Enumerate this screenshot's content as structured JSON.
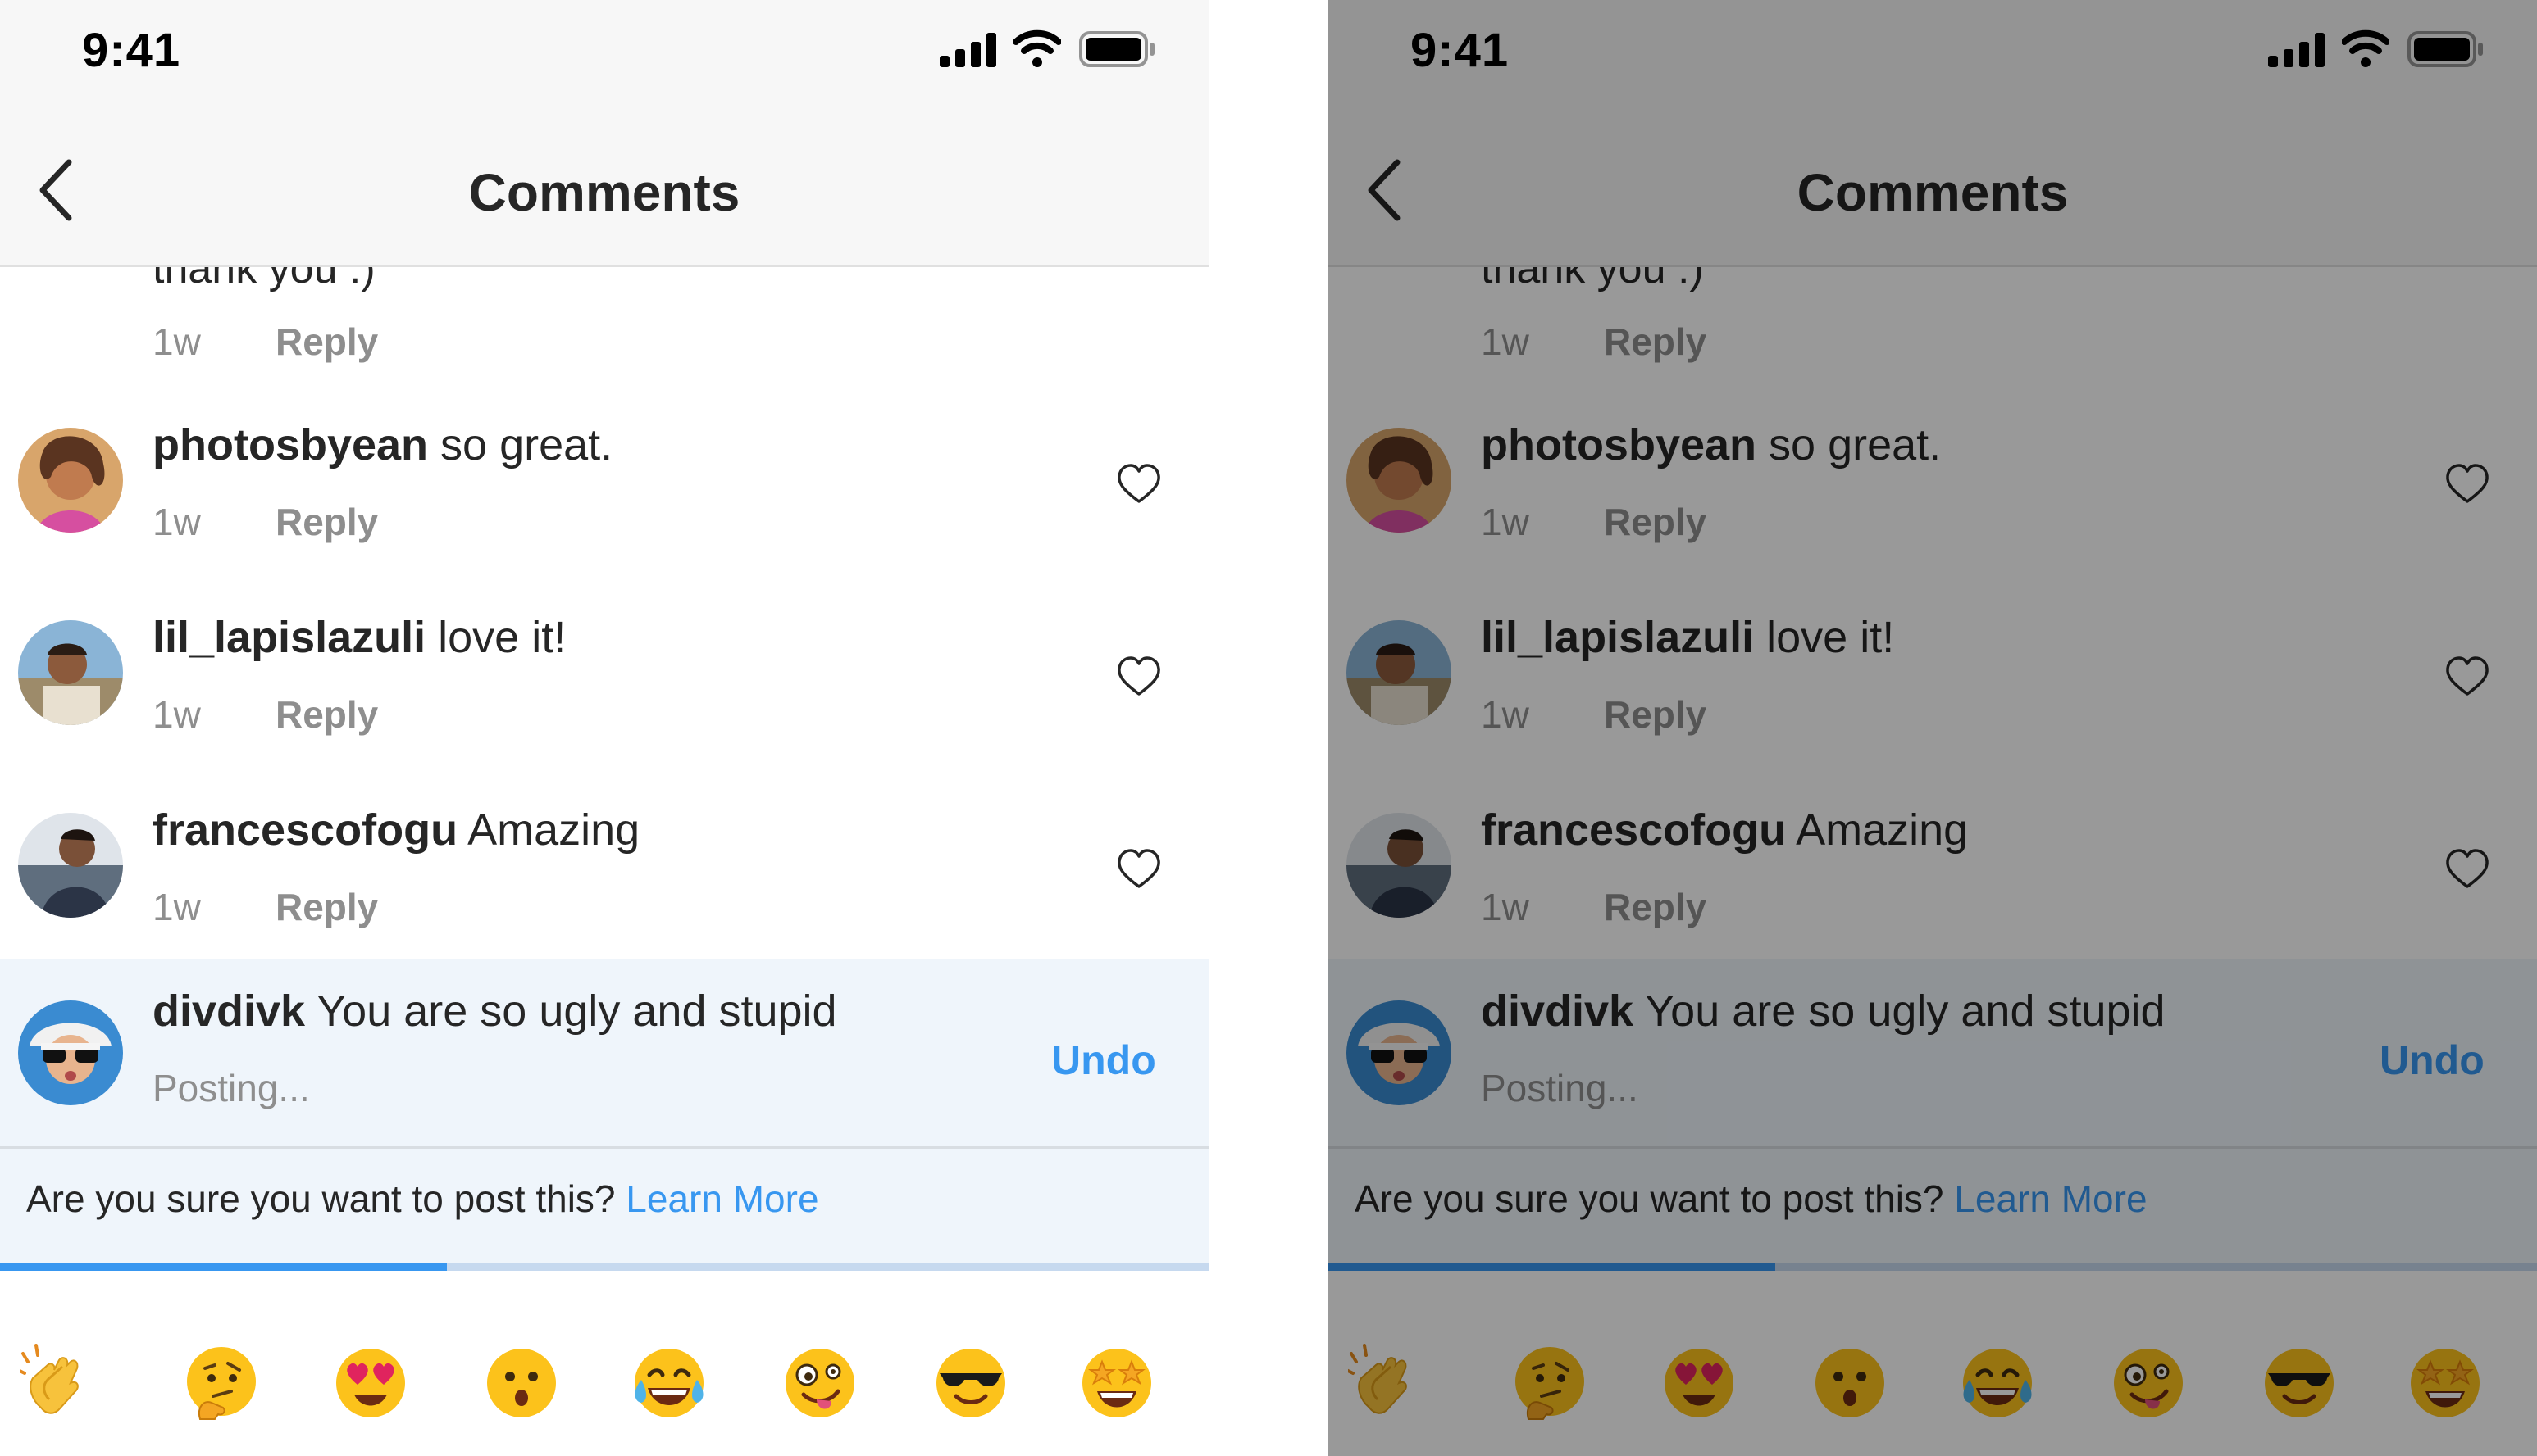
{
  "status": {
    "time": "9:41"
  },
  "nav": {
    "title": "Comments"
  },
  "partial_comment": {
    "text": "thank you :)",
    "age": "1w",
    "reply": "Reply"
  },
  "comments": [
    {
      "username": "photosbyean",
      "text": "so great.",
      "age": "1w",
      "reply": "Reply"
    },
    {
      "username": "lil_lapislazuli",
      "text": "love it!",
      "age": "1w",
      "reply": "Reply"
    },
    {
      "username": "francescofogu",
      "text": "Amazing",
      "age": "1w",
      "reply": "Reply"
    }
  ],
  "pending_comment": {
    "username": "divdivk",
    "text": "You are so ugly and stupid",
    "status": "Posting...",
    "undo": "Undo"
  },
  "notice": {
    "text": "Are you sure you want to post this?",
    "link": "Learn More"
  },
  "posting_progress": 0.37,
  "emoji_bar": [
    "clapping-hands",
    "thinking-face",
    "heart-eyes",
    "surprised-face",
    "tears-of-joy",
    "zany-face",
    "sunglasses-face",
    "star-struck"
  ],
  "colors": {
    "accent": "#3897f0",
    "pending_bg": "#eff5fb",
    "dim_overlay": "rgba(0,0,0,0.40)"
  }
}
